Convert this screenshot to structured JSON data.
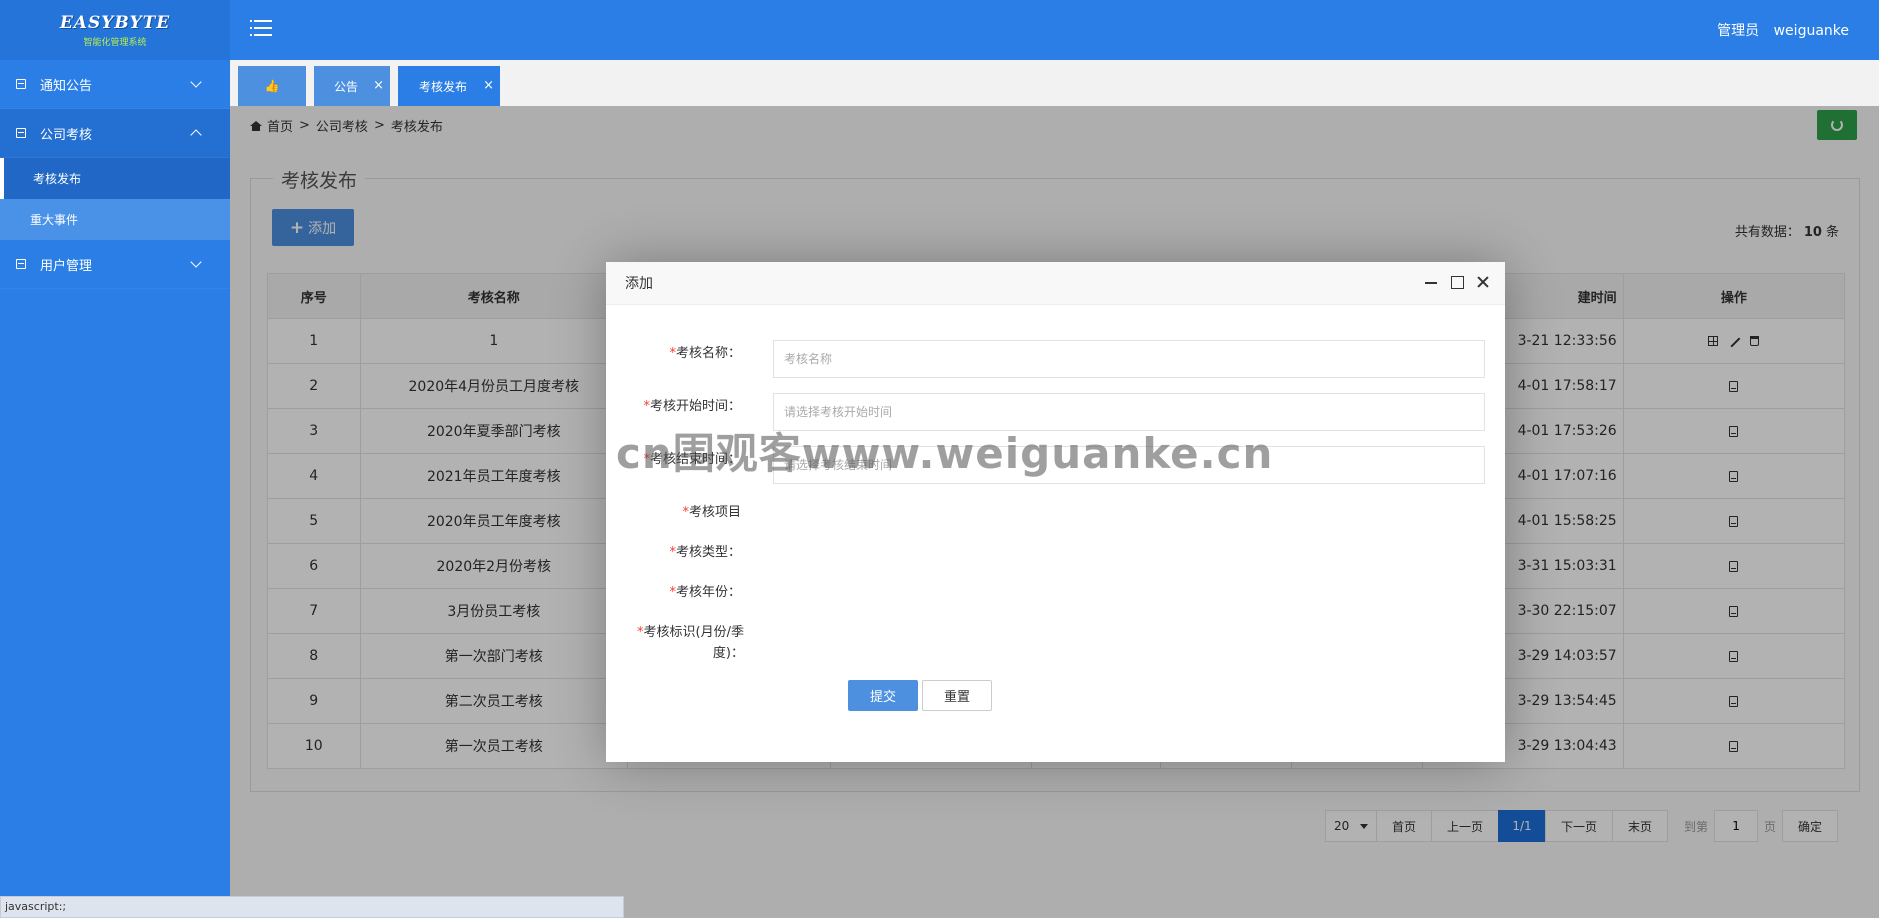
{
  "logo": {
    "text": "EASYBYTE",
    "sub": "智能化管理系统"
  },
  "header": {
    "role": "管理员",
    "username": "weiguanke"
  },
  "sidebar": {
    "groups": [
      {
        "label": "通知公告"
      },
      {
        "label": "公司考核",
        "children": [
          "考核发布",
          "重大事件"
        ]
      },
      {
        "label": "用户管理"
      }
    ]
  },
  "tabs": [
    {
      "label": "👍"
    },
    {
      "label": "公告",
      "close": "×"
    },
    {
      "label": "考核发布",
      "close": "×"
    }
  ],
  "breadcrumb": {
    "home": "首页",
    "sep": ">",
    "level1": "公司考核",
    "level2": "考核发布"
  },
  "panel": {
    "title": "考核发布",
    "add_label": "添加",
    "total_prefix": "共有数据：",
    "total_count": "10",
    "total_suffix": "条"
  },
  "table": {
    "headers": [
      "序号",
      "考核名称",
      "",
      "",
      "",
      "",
      "",
      "建时间",
      "操作"
    ],
    "rows": [
      {
        "no": "1",
        "name": "1",
        "time": "3-21 12:33:56"
      },
      {
        "no": "2",
        "name": "2020年4月份员工月度考核",
        "time": "4-01 17:58:17"
      },
      {
        "no": "3",
        "name": "2020年夏季部门考核",
        "time": "4-01 17:53:26"
      },
      {
        "no": "4",
        "name": "2021年员工年度考核",
        "time": "4-01 17:07:16"
      },
      {
        "no": "5",
        "name": "2020年员工年度考核",
        "time": "4-01 15:58:25"
      },
      {
        "no": "6",
        "name": "2020年2月份考核",
        "time": "3-31 15:03:31"
      },
      {
        "no": "7",
        "name": "3月份员工考核",
        "time": "3-30 22:15:07"
      },
      {
        "no": "8",
        "name": "第一次部门考核",
        "time": "3-29 14:03:57"
      },
      {
        "no": "9",
        "name": "第二次员工考核",
        "time": "3-29 13:54:45"
      },
      {
        "no": "10",
        "name": "第一次员工考核",
        "time": "3-29 13:04:43"
      }
    ]
  },
  "pager": {
    "size": "20",
    "first": "首页",
    "prev": "上一页",
    "current": "1/1",
    "next": "下一页",
    "last": "末页",
    "goto_prefix": "到第",
    "goto_value": "1",
    "goto_suffix": "页",
    "confirm": "确定"
  },
  "modal": {
    "title": "添加",
    "fields": [
      {
        "label": "考核名称：",
        "placeholder": "考核名称"
      },
      {
        "label": "考核开始时间：",
        "placeholder": "请选择考核开始时间"
      },
      {
        "label": "考核结束时间：",
        "placeholder": "请选择考核结束时间"
      },
      {
        "label": "考核项目"
      },
      {
        "label": "考核类型："
      },
      {
        "label": "考核年份："
      },
      {
        "label": "考核标识(月份/季度)："
      }
    ],
    "required_mark": "*",
    "submit": "提交",
    "reset": "重置"
  },
  "watermark": "cn围观客www.weiguanke.cn",
  "statusbar": "javascript:;",
  "colors": {
    "primary": "#2a7ee5",
    "refresh": "#2ea149",
    "required": "#ff3b30"
  }
}
